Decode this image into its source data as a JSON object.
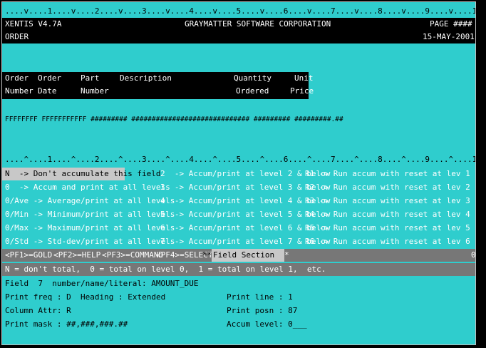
{
  "ruler_top": "....v....1....v....2....v....3....v....4....v....5....v....6....v....7....v....8....v....9....v....10...v....1....v....2....v....3...",
  "header": {
    "app": "XENTIS V4.7A",
    "company": "GRAYMATTER SOFTWARE CORPORATION",
    "page_label": "PAGE ####",
    "report": "ORDER",
    "date": "15-MAY-2001"
  },
  "columns": {
    "order_number": [
      "Order",
      "Number"
    ],
    "order_date": [
      "Order",
      "Date"
    ],
    "part_number": [
      "Part",
      "Number"
    ],
    "description": [
      "Description",
      ""
    ],
    "quantity": [
      "Quantity",
      "Ordered"
    ],
    "unit_price": [
      "Unit",
      "Price"
    ]
  },
  "detail_line": "FFFFFFFF FFFFFFFFFFF ######### ############################# ######### #########.##",
  "ruler_mid": "....^....1....^....2....^....3....^....4....^....5....^....6....^....7....^....8....^....9....^....10...^....1....^....2....^....3...",
  "options": [
    [
      "N  -> Don't accumulate this field",
      "2  -> Accum/print at level 2 & below",
      "R1 -> Run accum with reset at lev 1"
    ],
    [
      "0  -> Accum and print at all levels",
      "3  -> Accum/print at level 3 & below",
      "R2 -> Run accum with reset at lev 2"
    ],
    [
      "0/Ave -> Average/print at all levels",
      "4  -> Accum/print at level 4 & below",
      "R3 -> Run accum with reset at lev 3"
    ],
    [
      "0/Min -> Minimum/print at all levels",
      "5  -> Accum/print at level 5 & below",
      "R4 -> Run accum with reset at lev 4"
    ],
    [
      "0/Max -> Maximum/print at all levels",
      "6  -> Accum/print at level 6 & below",
      "R5 -> Run accum with reset at lev 5"
    ],
    [
      "0/Std -> Std-dev/print at all levels",
      "7  -> Accum/print at level 7 & below",
      "R6 -> Run accum with reset at lev 6"
    ]
  ],
  "fkeys": {
    "pf1": "<PF1>=GOLD",
    "pf2": "<PF2>=HELP",
    "pf3": "<PF3>=COMMAND",
    "pf4": "<PF4>=SELECT",
    "marker": "**",
    "section": "Field Section",
    "star": "*",
    "right_zero": "0"
  },
  "hint": "N = don't total,  0 = total on level 0,  1 = total on level 1,  etc.",
  "field_line": "Field  7  number/name/literal: AMOUNT_DUE",
  "props": {
    "print_freq": "Print freq : D",
    "heading": "Heading : Extended",
    "print_line": "Print line : 1",
    "column_attr": "Column Attr: R",
    "print_posn": "Print posn : 87",
    "print_mask": "Print mask : ##,###,###.##",
    "accum_level": "Accum level: 0___"
  }
}
